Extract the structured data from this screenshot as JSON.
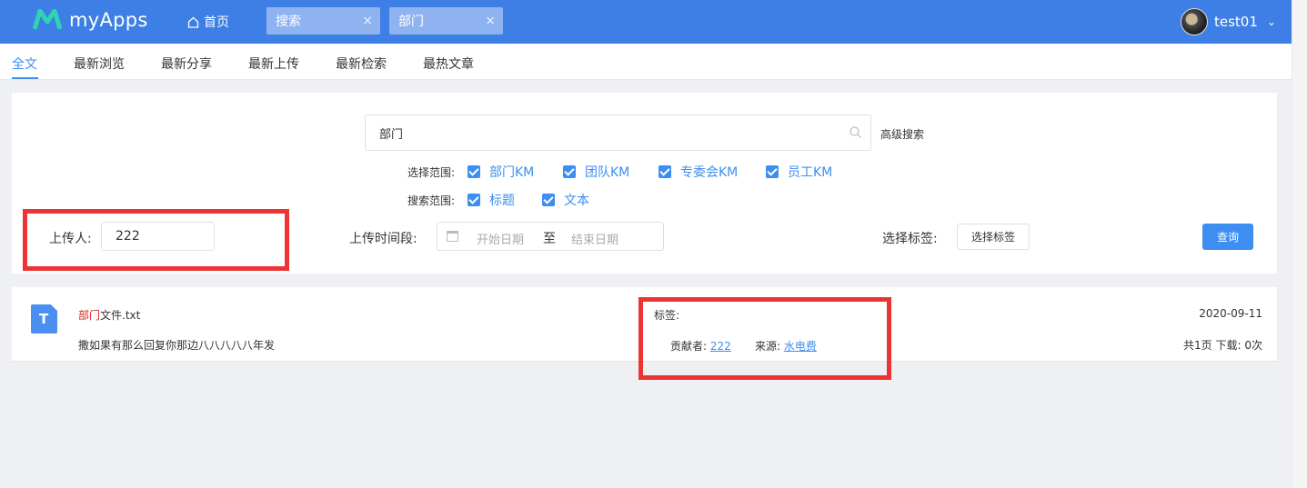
{
  "app": {
    "name": "myApps",
    "home_label": "首页"
  },
  "tabs": [
    {
      "label": "搜索",
      "close": "×"
    },
    {
      "label": "部门",
      "close": "×"
    }
  ],
  "user": {
    "name": "test01",
    "chevron": "⌄"
  },
  "subnav": {
    "items": [
      "全文",
      "最新浏览",
      "最新分享",
      "最新上传",
      "最新检索",
      "最热文章"
    ],
    "active": "全文"
  },
  "search": {
    "query": "部门",
    "advanced_label": "高级搜索",
    "scope_label": "选择范围:",
    "scopes": [
      "部门KM",
      "团队KM",
      "专委会KM",
      "员工KM"
    ],
    "field_label": "搜索范围:",
    "fields": [
      "标题",
      "文本"
    ]
  },
  "filters": {
    "uploader_label": "上传人:",
    "uploader_value": "222",
    "time_label": "上传时间段:",
    "start_placeholder": "开始日期",
    "range_sep": "至",
    "end_placeholder": "结束日期",
    "tag_label": "选择标签:",
    "tag_button": "选择标签",
    "query_button": "查询"
  },
  "result": {
    "icon_letter": "T",
    "title_highlight": "部门",
    "title_rest": "文件.txt",
    "snippet": "撒如果有那么回复你那边八八八八八年发",
    "tags_label": "标签:",
    "contributor_label": "贡献者:",
    "contributor": "222",
    "source_label": "来源:",
    "source": "水电费",
    "date": "2020-09-11",
    "stats": "共1页   下载:   0次"
  },
  "colors": {
    "header": "#3d7fe4",
    "accent": "#3d8ef0",
    "highlight": "#ee3333"
  }
}
